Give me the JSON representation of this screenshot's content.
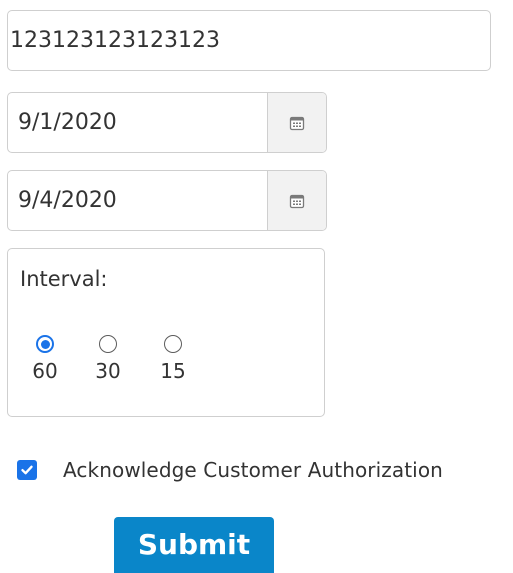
{
  "account": {
    "value": "123123123123123"
  },
  "start_date": {
    "value": "9/1/2020",
    "icon": "calendar-icon"
  },
  "end_date": {
    "value": "9/4/2020",
    "icon": "calendar-icon"
  },
  "interval": {
    "label": "Interval:",
    "options": [
      {
        "label": "60",
        "selected": true
      },
      {
        "label": "30",
        "selected": false
      },
      {
        "label": "15",
        "selected": false
      }
    ]
  },
  "acknowledge": {
    "label": "Acknowledge Customer Authorization",
    "checked": true
  },
  "submit": {
    "label": "Submit"
  },
  "colors": {
    "accent": "#1a73e8",
    "submit_bg": "#0a86c9",
    "border": "#cfcfcf",
    "text": "#333333"
  }
}
